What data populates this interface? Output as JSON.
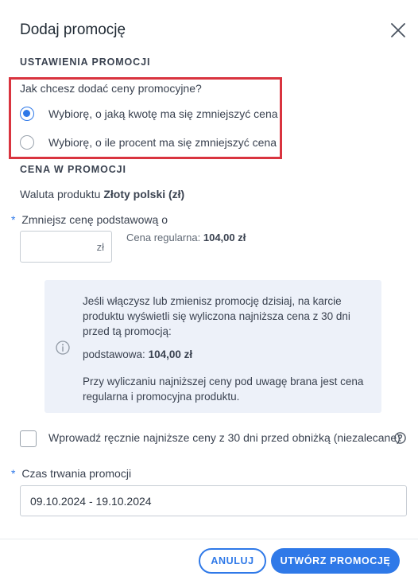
{
  "dialog": {
    "title": "Dodaj promocję"
  },
  "settings": {
    "section_label": "USTAWIENIA PROMOCJI",
    "question": "Jak chcesz dodać ceny promocyjne?",
    "options": [
      {
        "label": "Wybiorę, o jaką kwotę ma się zmniejszyć cena",
        "selected": true
      },
      {
        "label": "Wybiorę, o ile procent ma się zmniejszyć cena",
        "selected": false
      }
    ]
  },
  "price": {
    "section_label": "CENA W PROMOCJI",
    "currency_prefix": "Waluta produktu",
    "currency_name": "Złoty polski (zł)",
    "required_marker": "*",
    "reduce_label": "Zmniejsz cenę podstawową o",
    "reduce_value": "",
    "reduce_unit": "zł",
    "regular_label": "Cena regularna:",
    "regular_value": "104,00 zł"
  },
  "info": {
    "paragraph1": "Jeśli włączysz lub zmienisz promocję dzisiaj, na karcie produktu wyświetli się wyliczona najniższa cena z 30 dni przed tą promocją:",
    "base_label": "podstawowa:",
    "base_value": "104,00 zł",
    "paragraph2": "Przy wyliczaniu najniższej ceny pod uwagę brana jest cena regularna i promocyjna produktu."
  },
  "manual": {
    "label": "Wprowadź ręcznie najniższe ceny z 30 dni przed obniżką (niezalecane)",
    "checked": false
  },
  "duration": {
    "required_marker": "*",
    "label": "Czas trwania promocji",
    "value": "09.10.2024 - 19.10.2024"
  },
  "footer": {
    "cancel_label": "ANULUJ",
    "create_label": "UTWÓRZ PROMOCJĘ"
  },
  "colors": {
    "accent": "#2f79e8",
    "highlight": "#d9343f",
    "info_bg": "#edf1f9"
  },
  "icons": {
    "close": "close-icon",
    "info": "info-icon",
    "help": "help-icon"
  }
}
